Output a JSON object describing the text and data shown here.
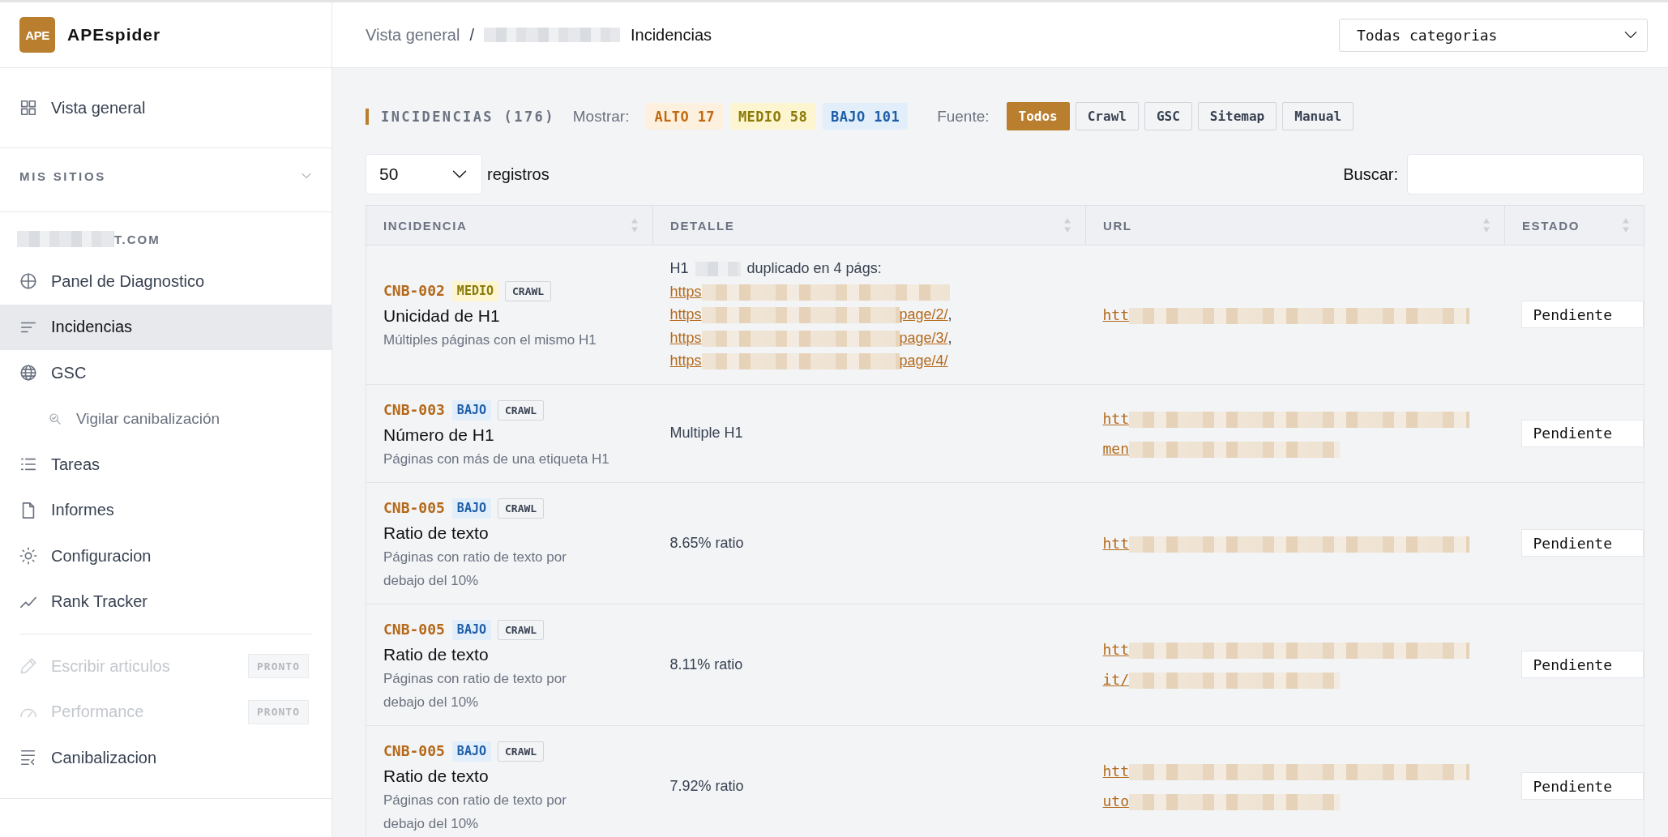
{
  "sidebar": {
    "brand": {
      "logo": "APE",
      "name": "APEspider"
    },
    "overview_item": {
      "label": "Vista general",
      "selected": false
    },
    "section": {
      "label": "MIS SITIOS",
      "expanded": true
    },
    "site": {
      "name": "T.COM"
    },
    "site_nav": [
      {
        "label": "Panel de Diagnostico",
        "selected": false,
        "disabled": false
      },
      {
        "label": "Incidencias",
        "selected": true,
        "disabled": false
      },
      {
        "label": "GSC",
        "selected": false,
        "disabled": false,
        "children": [
          {
            "label": "Vigilar canibalización",
            "selected": false,
            "disabled": false
          }
        ]
      },
      {
        "label": "Tareas",
        "selected": false,
        "disabled": false
      },
      {
        "label": "Informes",
        "selected": false,
        "disabled": false
      },
      {
        "label": "Configuracion",
        "selected": false,
        "disabled": false
      },
      {
        "label": "Rank Tracker",
        "selected": false,
        "disabled": false
      }
    ],
    "tools_nav": [
      {
        "label": "Escribir articulos",
        "selected": false,
        "disabled": true,
        "badge": "PRONTO"
      },
      {
        "label": "Performance",
        "selected": false,
        "disabled": true,
        "badge": "PRONTO"
      },
      {
        "label": "Canibalizacion",
        "selected": false,
        "disabled": false
      }
    ]
  },
  "header": {
    "breadcrumb": {
      "root": "Vista general",
      "separator": "/",
      "current": "Incidencias"
    },
    "category_select": {
      "value": "Todas categorias"
    }
  },
  "filters": {
    "title": "INCIDENCIAS (176)",
    "show_label": "Mostrar:",
    "severities": [
      {
        "label": "ALTO",
        "count": "17",
        "kind": "high"
      },
      {
        "label": "MEDIO",
        "count": "58",
        "kind": "medium"
      },
      {
        "label": "BAJO",
        "count": "101",
        "kind": "low"
      }
    ],
    "source_label": "Fuente:",
    "sources": [
      {
        "label": "Todos",
        "selected": true
      },
      {
        "label": "Crawl",
        "selected": false
      },
      {
        "label": "GSC",
        "selected": false
      },
      {
        "label": "Sitemap",
        "selected": false
      },
      {
        "label": "Manual",
        "selected": false
      }
    ]
  },
  "table_controls": {
    "page_size": "50",
    "page_size_label": "registros",
    "search_label": "Buscar:"
  },
  "table": {
    "columns": [
      {
        "label": "INCIDENCIA"
      },
      {
        "label": "DETALLE"
      },
      {
        "label": "URL"
      },
      {
        "label": "ESTADO"
      }
    ],
    "rows": [
      {
        "code": "CNB-002",
        "severity": {
          "label": "MEDIO",
          "kind": "medium"
        },
        "source": "CRAWL",
        "title": "Unicidad de H1",
        "description": "Múltiples páginas con el mismo H1",
        "detail": {
          "kind": "duplicates",
          "label": "H1",
          "text": "duplicado en 4 págs:",
          "links": [
            {
              "head": "https"
            },
            {
              "head": "https",
              "tail": "page/2/",
              "separator": ","
            },
            {
              "head": "https",
              "tail": "page/3/",
              "separator": ","
            },
            {
              "head": "https",
              "tail": "page/4/"
            }
          ]
        },
        "url": {
          "lines": [
            "htt"
          ]
        },
        "status": "Pendiente"
      },
      {
        "code": "CNB-003",
        "severity": {
          "label": "BAJO",
          "kind": "low"
        },
        "source": "CRAWL",
        "title": "Número de H1",
        "description": "Páginas con más de una etiqueta H1",
        "detail": {
          "kind": "text",
          "text": "Multiple H1"
        },
        "url": {
          "lines": [
            "htt",
            "men"
          ]
        },
        "status": "Pendiente"
      },
      {
        "code": "CNB-005",
        "severity": {
          "label": "BAJO",
          "kind": "low"
        },
        "source": "CRAWL",
        "title": "Ratio de texto",
        "description": "Páginas con ratio de texto por debajo del 10%",
        "detail": {
          "kind": "text",
          "text": "8.65% ratio"
        },
        "url": {
          "lines": [
            "htt"
          ]
        },
        "status": "Pendiente"
      },
      {
        "code": "CNB-005",
        "severity": {
          "label": "BAJO",
          "kind": "low"
        },
        "source": "CRAWL",
        "title": "Ratio de texto",
        "description": "Páginas con ratio de texto por debajo del 10%",
        "detail": {
          "kind": "text",
          "text": "8.11% ratio"
        },
        "url": {
          "lines": [
            "htt",
            "it/"
          ]
        },
        "status": "Pendiente"
      },
      {
        "code": "CNB-005",
        "severity": {
          "label": "BAJO",
          "kind": "low"
        },
        "source": "CRAWL",
        "title": "Ratio de texto",
        "description": "Páginas con ratio de texto por debajo del 10%",
        "detail": {
          "kind": "text",
          "text": "7.92% ratio"
        },
        "url": {
          "lines": [
            "htt",
            "uto"
          ]
        },
        "status": "Pendiente"
      }
    ]
  }
}
